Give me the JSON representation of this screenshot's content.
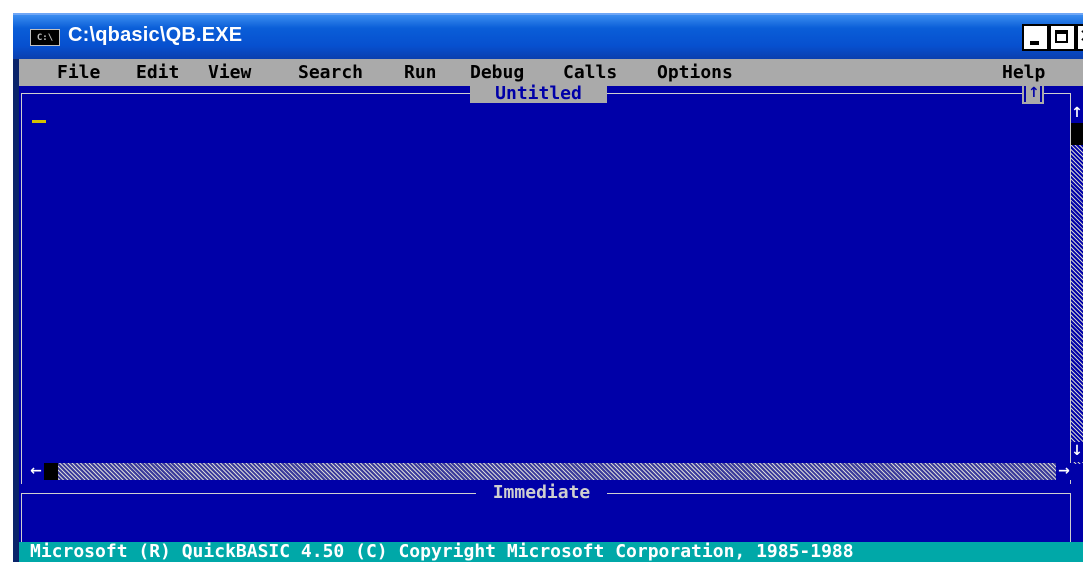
{
  "window": {
    "title": "C:\\qbasic\\QB.EXE",
    "icon": "console-icon",
    "icon_text": "C:\\"
  },
  "menu": {
    "items": [
      "File",
      "Edit",
      "View",
      "Search",
      "Run",
      "Debug",
      "Calls",
      "Options"
    ],
    "help": "Help"
  },
  "editor": {
    "title": "Untitled",
    "content": ""
  },
  "immediate": {
    "title": "Immediate"
  },
  "scrollbar": {
    "up_arrow": "↑",
    "down_arrow": "↓",
    "left_arrow": "←",
    "right_arrow": "→",
    "maximize_glyph": "↑"
  },
  "status": {
    "text": "Microsoft (R) QuickBASIC 4.50 (C) Copyright Microsoft Corporation, 1985-1988"
  },
  "colors": {
    "background": "#0000a8",
    "menu_bar": "#aaaaaa",
    "status_bar": "#00a8a8",
    "cursor": "#d4c000"
  }
}
